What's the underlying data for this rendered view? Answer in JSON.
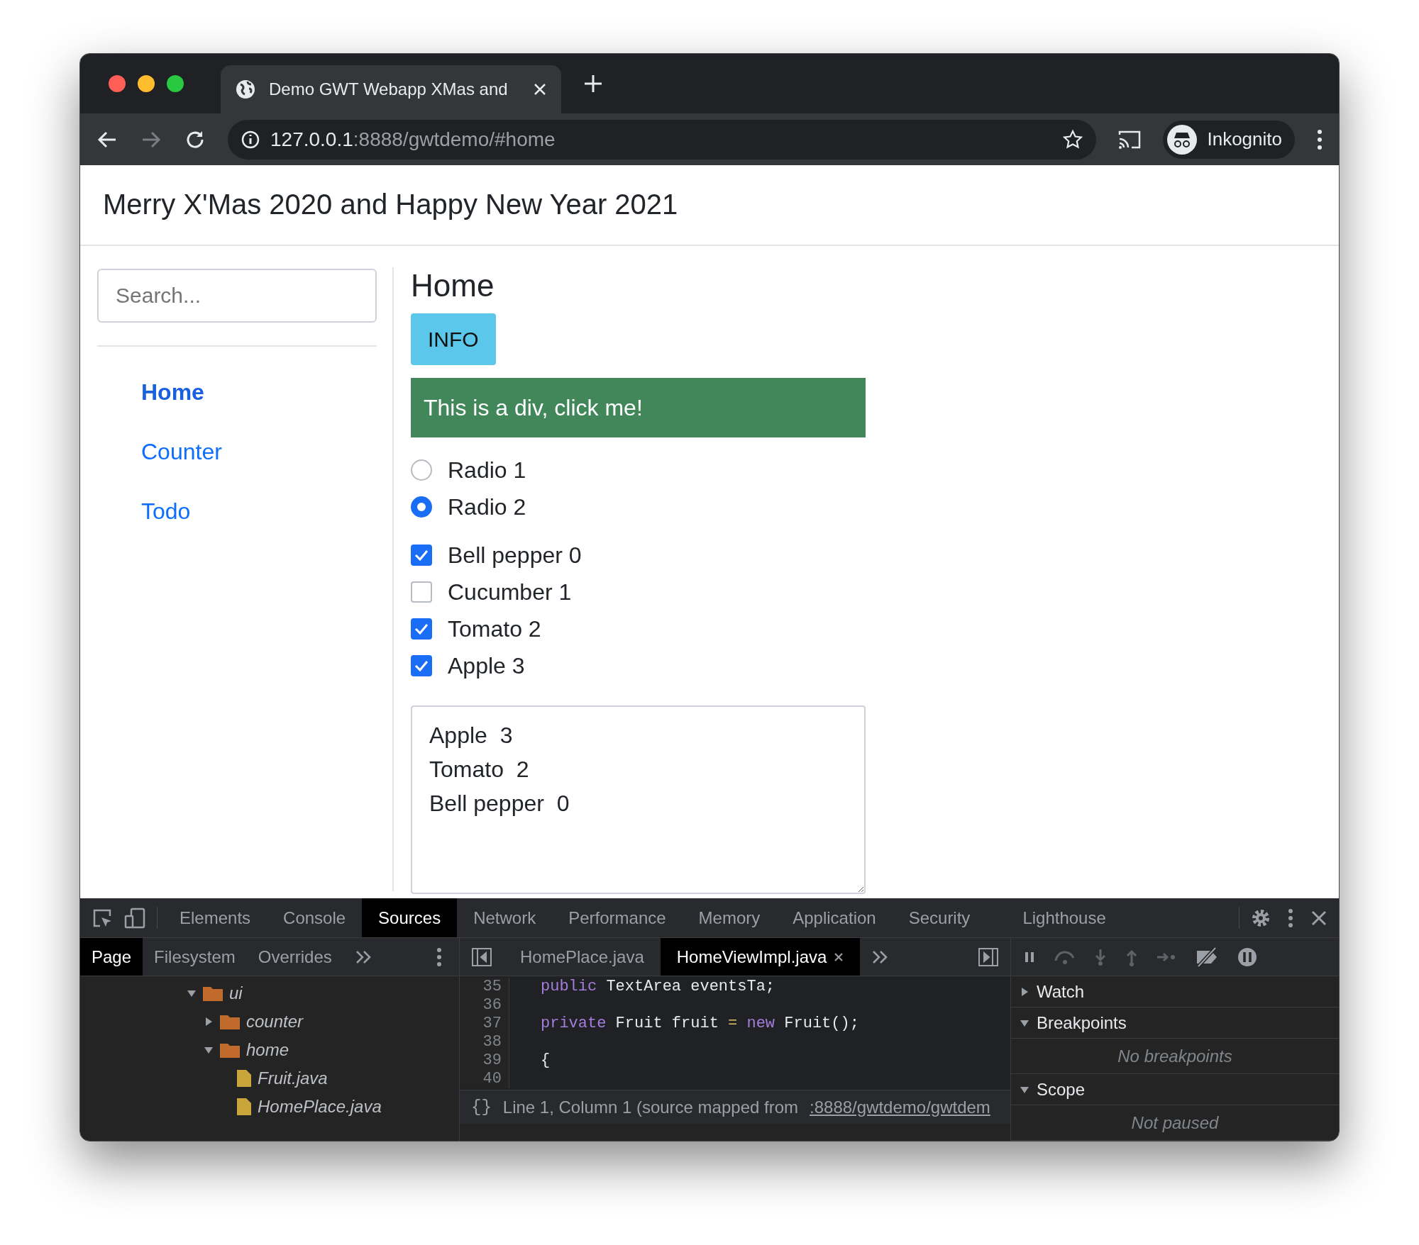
{
  "browser": {
    "tab_title": "Demo GWT Webapp XMas and",
    "url_host": "127.0.0.1",
    "url_rest": ":8888/gwtdemo/#home",
    "profile": "Inkognito"
  },
  "page": {
    "title": "Merry X'Mas 2020 and Happy New Year 2021",
    "search": {
      "placeholder": "Search..."
    },
    "nav": [
      {
        "label": "Home",
        "selected": true
      },
      {
        "label": "Counter",
        "selected": false
      },
      {
        "label": "Todo",
        "selected": false
      }
    ],
    "heading": "Home",
    "info_button": "INFO",
    "click_div": "This is a div, click me!",
    "radios": [
      {
        "label": "Radio 1",
        "selected": false
      },
      {
        "label": "Radio 2",
        "selected": true
      }
    ],
    "checkboxes": [
      {
        "label": "Bell pepper 0",
        "checked": true
      },
      {
        "label": "Cucumber 1",
        "checked": false
      },
      {
        "label": "Tomato 2",
        "checked": true
      },
      {
        "label": "Apple 3",
        "checked": true
      }
    ],
    "textarea_lines": [
      "Apple  3",
      "Tomato  2",
      "Bell pepper  0"
    ]
  },
  "devtools": {
    "tabs": [
      {
        "label": "Elements",
        "selected": false
      },
      {
        "label": "Console",
        "selected": false
      },
      {
        "label": "Sources",
        "selected": true
      },
      {
        "label": "Network",
        "selected": false
      },
      {
        "label": "Performance",
        "selected": false
      },
      {
        "label": "Memory",
        "selected": false
      },
      {
        "label": "Application",
        "selected": false
      },
      {
        "label": "Security",
        "selected": false
      },
      {
        "label": "Lighthouse",
        "selected": false
      }
    ],
    "navigator_tabs": [
      {
        "label": "Page",
        "selected": true
      },
      {
        "label": "Filesystem",
        "selected": false
      },
      {
        "label": "Overrides",
        "selected": false
      }
    ],
    "tree": [
      {
        "label": "ui",
        "kind": "folder",
        "expanded": true,
        "children": [
          {
            "label": "counter",
            "kind": "folder",
            "expanded": false
          },
          {
            "label": "home",
            "kind": "folder",
            "expanded": true,
            "children": [
              {
                "label": "Fruit.java",
                "kind": "file"
              },
              {
                "label": "HomePlace.java",
                "kind": "file"
              }
            ]
          }
        ]
      }
    ],
    "editor_tabs": [
      {
        "label": "HomePlace.java",
        "selected": false
      },
      {
        "label": "HomeViewImpl.java",
        "selected": true
      }
    ],
    "code_lines": [
      {
        "number": "35",
        "tokens": [
          {
            "kind": "keyword",
            "text": "public"
          },
          {
            "kind": "plain",
            "text": " TextArea eventsTa;"
          }
        ]
      },
      {
        "number": "36"
      },
      {
        "number": "37",
        "tokens": [
          {
            "kind": "keyword",
            "text": "private"
          },
          {
            "kind": "plain",
            "text": " Fruit fruit "
          },
          {
            "kind": "operator",
            "text": "= "
          },
          {
            "kind": "keyword",
            "text": "new"
          },
          {
            "kind": "plain",
            "text": " Fruit();"
          }
        ]
      },
      {
        "number": "38"
      },
      {
        "number": "39",
        "tokens": [
          {
            "kind": "plain",
            "text": "{"
          }
        ]
      },
      {
        "number": "40"
      }
    ],
    "status": {
      "pretty_print": "{}",
      "text": "Line 1, Column 1  (source mapped from",
      "link": ":8888/gwtdemo/gwtdem"
    },
    "sections": [
      {
        "title": "Watch",
        "expanded": false
      },
      {
        "title": "Breakpoints",
        "expanded": true,
        "body": "No breakpoints"
      },
      {
        "title": "Scope",
        "expanded": true,
        "body": "Not paused"
      }
    ]
  }
}
